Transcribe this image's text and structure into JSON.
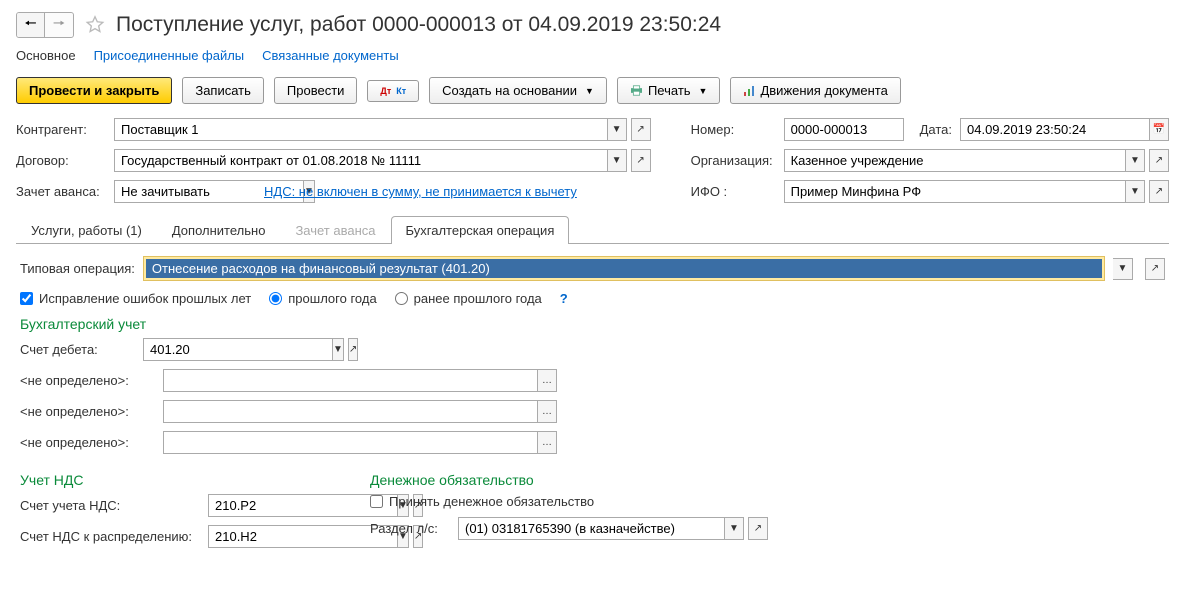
{
  "title": "Поступление услуг, работ 0000-000013 от 04.09.2019 23:50:24",
  "linkTabs": {
    "main": "Основное",
    "files": "Присоединенные файлы",
    "related": "Связанные документы"
  },
  "toolbar": {
    "process_close": "Провести и закрыть",
    "save": "Записать",
    "process": "Провести",
    "create_based": "Создать на основании",
    "print": "Печать",
    "movements": "Движения документа"
  },
  "fields": {
    "contractor_label": "Контрагент:",
    "contractor_value": "Поставщик 1",
    "contract_label": "Договор:",
    "contract_value": "Государственный контракт от 01.08.2018 № 11111",
    "advance_label": "Зачет аванса:",
    "advance_value": "Не зачитывать",
    "vat_link": "НДС: не включен в сумму, не принимается к вычету",
    "number_label": "Номер:",
    "number_value": "0000-000013",
    "date_label": "Дата:",
    "date_value": "04.09.2019 23:50:24",
    "org_label": "Организация:",
    "org_value": "Казенное учреждение",
    "ifo_label": "ИФО :",
    "ifo_value": "Пример Минфина РФ"
  },
  "tabs": {
    "services": "Услуги, работы (1)",
    "additional": "Дополнительно",
    "advance_offset": "Зачет аванса",
    "accounting": "Бухгалтерская операция"
  },
  "accounting": {
    "typical_op_label": "Типовая операция:",
    "typical_op_value": "Отнесение расходов на финансовый результат (401.20)",
    "fix_errors_label": "Исправление ошибок прошлых лет",
    "radio_last_year": "прошлого года",
    "radio_earlier": "ранее прошлого года",
    "section_accounting": "Бухгалтерский учет",
    "debit_label": "Счет дебета:",
    "debit_value": "401.20",
    "undef": "<не определено>:",
    "section_vat": "Учет НДС",
    "vat_account_label": "Счет учета НДС:",
    "vat_account_value": "210.Р2",
    "vat_dist_label": "Счет НДС к распределению:",
    "vat_dist_value": "210.Н2",
    "section_money": "Денежное обязательство",
    "accept_money_label": "Принять денежное обязательство",
    "section_ls_label": "Раздел л/с:",
    "section_ls_value": "(01) 03181765390 (в казначействе)"
  }
}
